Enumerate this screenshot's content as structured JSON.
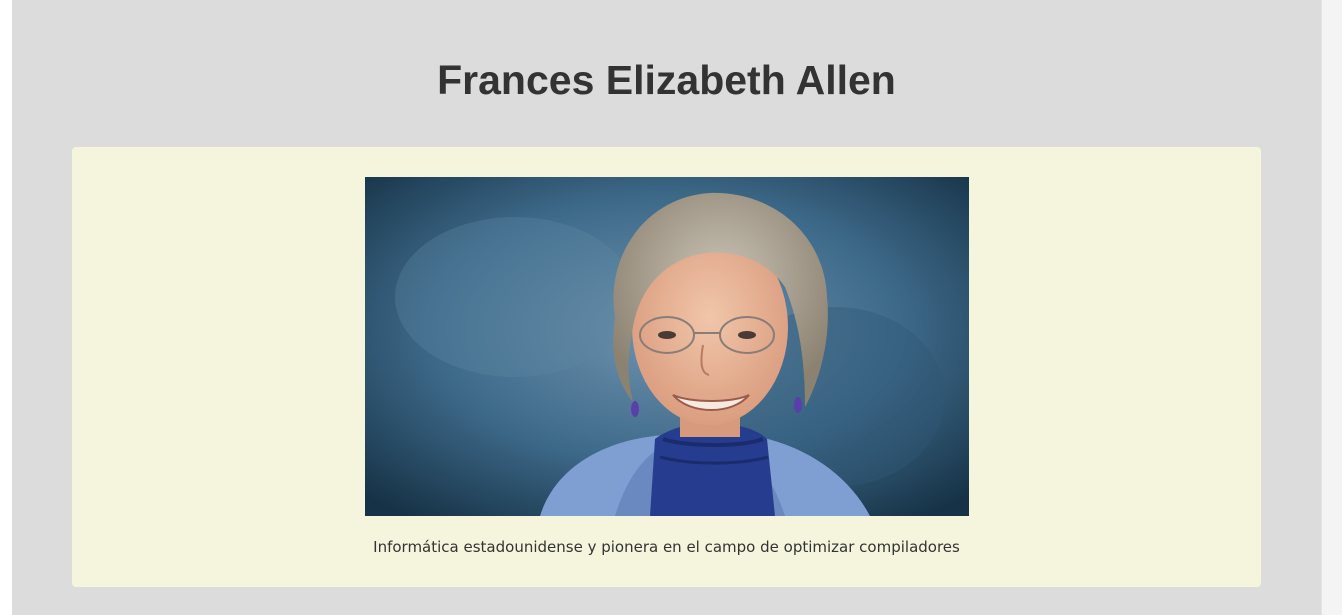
{
  "header": {
    "title": "Frances Elizabeth Allen"
  },
  "card": {
    "photo_icon": "portrait-photo",
    "caption": "Informática estadounidense y pionera en el campo de optimizar compiladores"
  },
  "colors": {
    "page_background": "#dcdcdc",
    "card_background": "#f5f5de",
    "text": "#333333"
  }
}
